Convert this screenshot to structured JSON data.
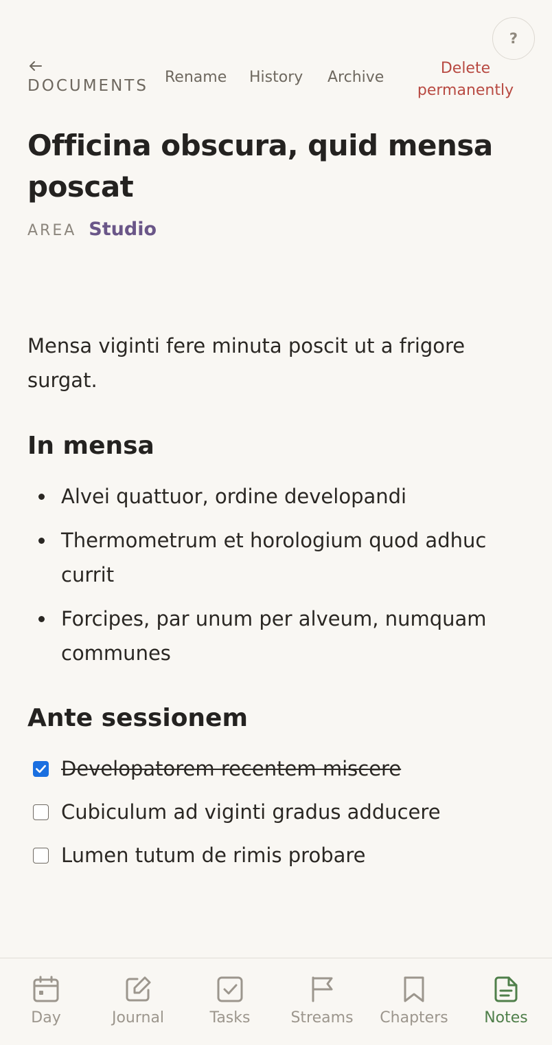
{
  "header": {
    "help_label": "?",
    "back_label": "DOCUMENTS",
    "actions": {
      "rename": "Rename",
      "history": "History",
      "archive": "Archive",
      "delete": "Delete permanently"
    }
  },
  "document": {
    "title": "Officina obscura, quid mensa poscat",
    "area_label": "AREA",
    "area_value": "Studio",
    "intro": "Mensa viginti fere minuta poscit ut a frigore surgat.",
    "section1": {
      "heading": "In mensa",
      "items": [
        "Alvei quattuor, ordine developandi",
        "Thermometrum et horologium quod adhuc currit",
        "Forcipes, par unum per alveum, numquam communes"
      ]
    },
    "section2": {
      "heading": "Ante sessionem",
      "tasks": [
        {
          "text": "Developatorem recentem miscere",
          "checked": true
        },
        {
          "text": "Cubiculum ad viginti gradus adducere",
          "checked": false
        },
        {
          "text": "Lumen tutum de rimis probare",
          "checked": false
        }
      ]
    }
  },
  "tabbar": {
    "items": [
      {
        "label": "Day",
        "icon": "calendar-icon"
      },
      {
        "label": "Journal",
        "icon": "pencil-square-icon"
      },
      {
        "label": "Tasks",
        "icon": "checkbox-icon"
      },
      {
        "label": "Streams",
        "icon": "flag-icon"
      },
      {
        "label": "Chapters",
        "icon": "bookmark-icon"
      },
      {
        "label": "Notes",
        "icon": "document-icon"
      }
    ],
    "active": "Notes"
  },
  "colors": {
    "background": "#f9f7f3",
    "accent_area": "#6a5688",
    "danger": "#b84a42",
    "active_tab": "#4f7f4a",
    "checkbox_checked": "#1a6fe0"
  }
}
